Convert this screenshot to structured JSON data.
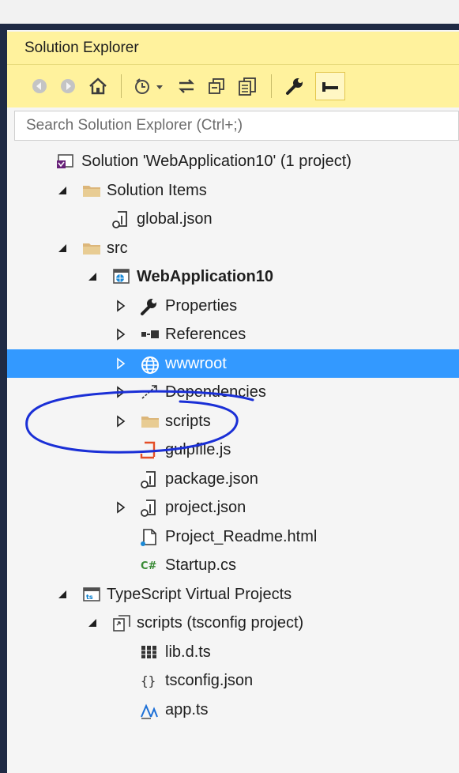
{
  "panel": {
    "title": "Solution Explorer",
    "search_placeholder": "Search Solution Explorer (Ctrl+;)"
  },
  "toolbar": {
    "icons": [
      "back-icon",
      "forward-icon",
      "home-icon",
      "pending-changes-icon",
      "sync-icon",
      "collapse-all-icon",
      "show-all-files-icon",
      "properties-icon",
      "pin-icon"
    ]
  },
  "tree": [
    {
      "label": "Solution 'WebApplication10' (1 project)",
      "icon": "solution-icon",
      "indent": 0,
      "arrow": "none"
    },
    {
      "label": "Solution Items",
      "icon": "folder-icon",
      "indent": 1,
      "arrow": "expanded"
    },
    {
      "label": "global.json",
      "icon": "json-file-icon",
      "indent": 2,
      "arrow": "none"
    },
    {
      "label": "src",
      "icon": "folder-icon",
      "indent": 1,
      "arrow": "expanded"
    },
    {
      "label": "WebApplication10",
      "icon": "web-project-icon",
      "indent": 2,
      "arrow": "expanded",
      "bold": true
    },
    {
      "label": "Properties",
      "icon": "wrench-icon",
      "indent": 3,
      "arrow": "collapsed"
    },
    {
      "label": "References",
      "icon": "references-icon",
      "indent": 3,
      "arrow": "collapsed"
    },
    {
      "label": "wwwroot",
      "icon": "globe-icon",
      "indent": 3,
      "arrow": "collapsed",
      "selected": true
    },
    {
      "label": "Dependencies",
      "icon": "dependencies-icon",
      "indent": 3,
      "arrow": "collapsed"
    },
    {
      "label": "scripts",
      "icon": "folder-icon",
      "indent": 3,
      "arrow": "collapsed"
    },
    {
      "label": "gulpfile.js",
      "icon": "js-file-icon",
      "indent": 3,
      "arrow": "none"
    },
    {
      "label": "package.json",
      "icon": "json-file-icon",
      "indent": 3,
      "arrow": "none"
    },
    {
      "label": "project.json",
      "icon": "json-file-icon",
      "indent": 3,
      "arrow": "collapsed"
    },
    {
      "label": "Project_Readme.html",
      "icon": "html-file-icon",
      "indent": 3,
      "arrow": "none"
    },
    {
      "label": "Startup.cs",
      "icon": "csharp-file-icon",
      "indent": 3,
      "arrow": "none"
    },
    {
      "label": "TypeScript Virtual Projects",
      "icon": "ts-virtual-projects-icon",
      "indent": 1,
      "arrow": "expanded"
    },
    {
      "label": "scripts (tsconfig project)",
      "icon": "tsconfig-project-icon",
      "indent": 2,
      "arrow": "expanded"
    },
    {
      "label": "lib.d.ts",
      "icon": "dts-file-icon",
      "indent": 3,
      "arrow": "none"
    },
    {
      "label": "tsconfig.json",
      "icon": "braces-file-icon",
      "indent": 3,
      "arrow": "none"
    },
    {
      "label": "app.ts",
      "icon": "ts-file-icon",
      "indent": 3,
      "arrow": "none"
    }
  ],
  "colors": {
    "title_bg": "#fff29d",
    "selection": "#3399ff",
    "frame": "#1f2a44",
    "annotation": "#1a2fd6"
  }
}
